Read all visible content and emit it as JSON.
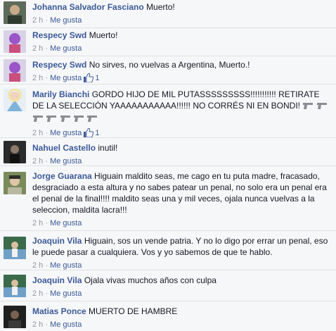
{
  "comments": [
    {
      "author": "Johanna Salvador Fasciano",
      "text": "Muerto!",
      "time": "2 h",
      "like_label": "Me gusta",
      "likes": null
    },
    {
      "author": "Respecy Swd",
      "text": "Muerto!",
      "time": "2 h",
      "like_label": "Me gusta",
      "likes": null
    },
    {
      "author": "Respecy Swd",
      "text": "No sirves, no vuelvas a Argentina, Muerto.!",
      "time": "2 h",
      "like_label": "Me gusta",
      "likes": "1"
    },
    {
      "author": "Marily Bianchi",
      "text": "GORDO HIJO DE MIL PUTASSSSSSSSS!!!!!!!!!!! RETIRATE DE LA SELECCIÓN YAAAAAAAAAAA!!!!!! NO CORRÉS NI EN BONDI!",
      "time": "2 h",
      "like_label": "Me gusta",
      "likes": "1",
      "emoji_icon": "pistol-icon",
      "emoji_count": 7
    },
    {
      "author": "Nahuel Castello",
      "text": "inutil!",
      "time": "2 h",
      "like_label": "Me gusta",
      "likes": null
    },
    {
      "author": "Jorge Guarana",
      "text": "Higuain maldito seas, me cago en tu puta madre, fracasado, desgraciado a esta altura y no sabes patear un penal, no solo era un penal era el penal de la final!!!! maldito seas una y mil veces, ojala nunca vuelvas a la seleccion, maldita lacra!!!",
      "time": "2 h",
      "like_label": "Me gusta",
      "likes": null
    },
    {
      "author": "Joaquin Vila",
      "text": "Higuain, sos un vende patria. Y no lo digo por errar un penal, eso le puede pasar a cualquiera. Vos y yo sabemos de que te hablo.",
      "time": "2 h",
      "like_label": "Me gusta",
      "likes": null
    },
    {
      "author": "Joaquin Vila",
      "text": "Ojala vivas muchos años con culpa",
      "time": "2 h",
      "like_label": "Me gusta",
      "likes": null
    },
    {
      "author": "Matias Ponce",
      "text": "MUERTO DE HAMBRE",
      "time": "2 h",
      "like_label": "Me gusta",
      "likes": null
    }
  ],
  "separator": " · ",
  "colors": {
    "link": "#3b5998",
    "meta": "#90949c",
    "background": "#f6f7f9"
  }
}
